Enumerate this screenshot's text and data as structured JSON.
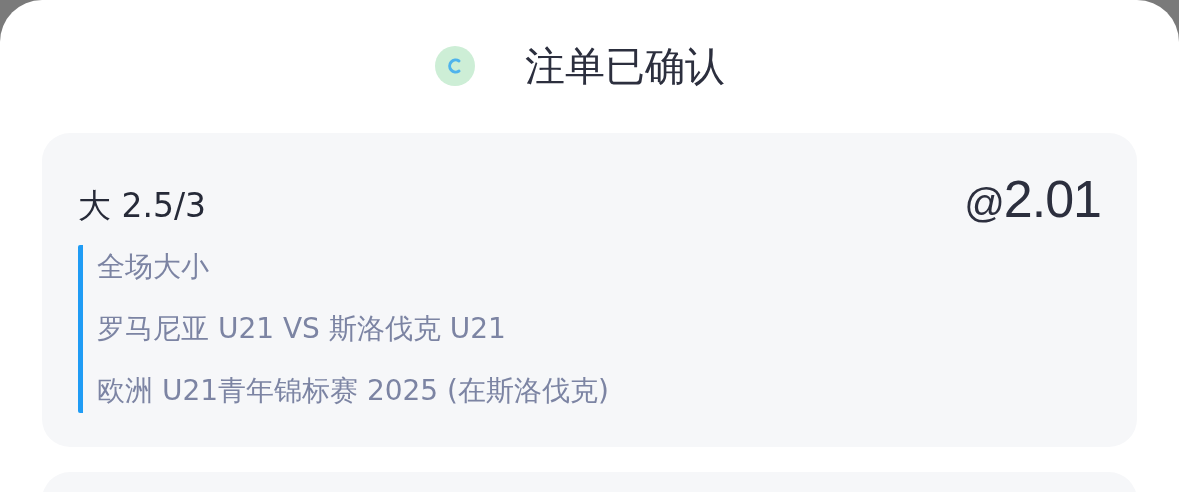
{
  "header": {
    "title": "注单已确认"
  },
  "bets": [
    {
      "selection": "大 2.5/3",
      "odds_prefix": "@",
      "odds": "2.01",
      "details": [
        "全场大小",
        "罗马尼亚 U21 VS 斯洛伐克 U21",
        "欧洲 U21青年锦标赛 2025 (在斯洛伐克)"
      ]
    }
  ]
}
